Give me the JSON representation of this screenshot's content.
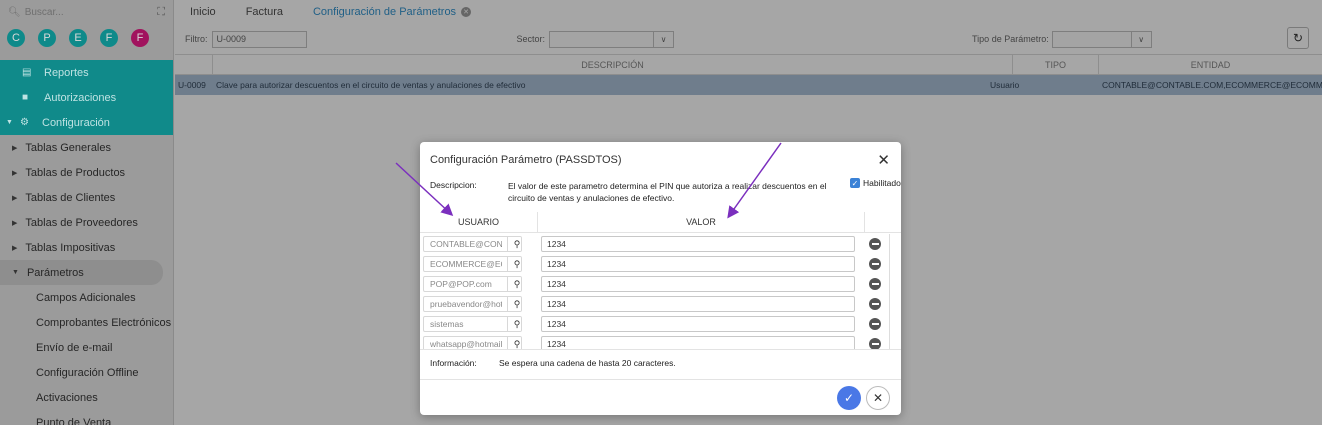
{
  "sidebar": {
    "search_placeholder": "Buscar...",
    "circles": [
      "C",
      "P",
      "E",
      "F",
      "F"
    ],
    "circle_colors": [
      "#0e8a8a",
      "#0e8a8a",
      "#0e8a8a",
      "#0e8a8a",
      "#a1135e"
    ],
    "teal_items": [
      {
        "label": "Reportes",
        "icon": "report-icon"
      },
      {
        "label": "Autorizaciones",
        "icon": "lock-icon"
      }
    ],
    "config_label": "Configuración",
    "nav_items": [
      "Tablas Generales",
      "Tablas de Productos",
      "Tablas de Clientes",
      "Tablas de Proveedores",
      "Tablas Impositivas"
    ],
    "params_label": "Parámetros",
    "sub_items": [
      "Campos Adicionales",
      "Comprobantes Electrónicos",
      "Envío de e-mail",
      "Configuración Offline",
      "Activaciones",
      "Punto de Venta"
    ]
  },
  "tabs": [
    {
      "label": "Inicio"
    },
    {
      "label": "Factura"
    },
    {
      "label": "Configuración de Parámetros"
    }
  ],
  "filters": {
    "filtro_label": "Filtro:",
    "filtro_value": "U-0009",
    "sector_label": "Sector:",
    "tipo_label": "Tipo de Parámetro:"
  },
  "grid": {
    "headers": [
      "DESCRIPCIÓN",
      "TIPO",
      "ENTIDAD"
    ],
    "row": {
      "code": "U-0009",
      "description": "Clave para autorizar descuentos en el circuito de ventas y anulaciones de efectivo",
      "tipo": "Usuario",
      "entidad": "CONTABLE@CONTABLE.COM,ECOMMERCE@ECOMMER"
    }
  },
  "modal": {
    "title": "Configuración Parámetro (PASSDTOS)",
    "desc_label": "Descripcion:",
    "desc_text": "El valor de este parametro determina el PIN que autoriza a realizar descuentos en el circuito de ventas y anulaciones de efectivo.",
    "habilitado_label": "Habilitado",
    "col_usuario": "USUARIO",
    "col_valor": "VALOR",
    "rows": [
      {
        "usuario": "CONTABLE@CONT",
        "valor": "1234"
      },
      {
        "usuario": "ECOMMERCE@EC",
        "valor": "1234"
      },
      {
        "usuario": "POP@POP.com",
        "valor": "1234"
      },
      {
        "usuario": "pruebavendor@hot",
        "valor": "1234"
      },
      {
        "usuario": "sistemas",
        "valor": "1234"
      },
      {
        "usuario": "whatsapp@hotmail.",
        "valor": "1234"
      }
    ],
    "info_label": "Información:",
    "info_text": "Se espera una cadena de hasta 20 caracteres."
  },
  "colors": {
    "accent": "#4a78e6",
    "teal": "#108a8a",
    "arrow": "#7b2fbe"
  }
}
